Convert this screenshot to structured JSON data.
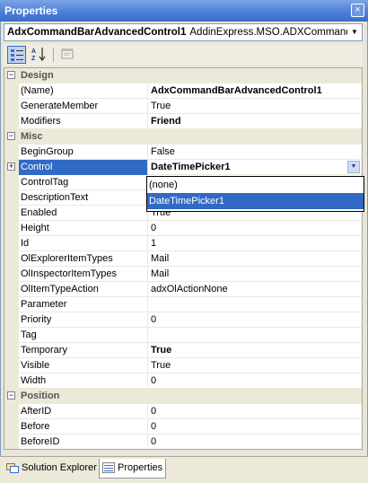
{
  "window": {
    "title": "Properties",
    "close_glyph": "×"
  },
  "object_selector": {
    "name": "AdxCommandBarAdvancedControl1",
    "type": "AddinExpress.MSO.ADXCommandBa",
    "arrow_icon": "chevron-down-icon"
  },
  "toolbar": {
    "buttons": [
      {
        "name": "categorized-button",
        "icon": "categorized-icon",
        "active": true
      },
      {
        "name": "alphabetical-button",
        "icon": "alphabetical-icon",
        "active": false
      },
      {
        "name": "property-pages-button",
        "icon": "property-pages-icon",
        "active": false
      }
    ]
  },
  "grid": {
    "categories": {
      "design": {
        "label": "Design",
        "expander": "−"
      },
      "misc": {
        "label": "Misc",
        "expander": "−"
      },
      "position": {
        "label": "Position",
        "expander": "−"
      }
    },
    "design": [
      {
        "key": "(Name)",
        "value": "AdxCommandBarAdvancedControl1",
        "bold": true
      },
      {
        "key": "GenerateMember",
        "value": "True",
        "bold": false
      },
      {
        "key": "Modifiers",
        "value": "Friend",
        "bold": true
      }
    ],
    "misc": [
      {
        "key": "BeginGroup",
        "value": "False",
        "bold": false
      },
      {
        "key": "Control",
        "value": "DateTimePicker1",
        "bold": true,
        "selected": true,
        "expander": "+"
      },
      {
        "key": "ControlTag",
        "value": "",
        "bold": false
      },
      {
        "key": "DescriptionText",
        "value": "",
        "bold": false
      },
      {
        "key": "Enabled",
        "value": "True",
        "bold": false
      },
      {
        "key": "Height",
        "value": "0",
        "bold": false
      },
      {
        "key": "Id",
        "value": "1",
        "bold": false
      },
      {
        "key": "OlExplorerItemTypes",
        "value": "Mail",
        "bold": false
      },
      {
        "key": "OlInspectorItemTypes",
        "value": "Mail",
        "bold": false
      },
      {
        "key": "OlItemTypeAction",
        "value": "adxOlActionNone",
        "bold": false
      },
      {
        "key": "Parameter",
        "value": "",
        "bold": false
      },
      {
        "key": "Priority",
        "value": "0",
        "bold": false
      },
      {
        "key": "Tag",
        "value": "",
        "bold": false
      },
      {
        "key": "Temporary",
        "value": "True",
        "bold": true
      },
      {
        "key": "Visible",
        "value": "True",
        "bold": false
      },
      {
        "key": "Width",
        "value": "0",
        "bold": false
      }
    ],
    "position": [
      {
        "key": "AfterID",
        "value": "0",
        "bold": false
      },
      {
        "key": "Before",
        "value": "0",
        "bold": false
      },
      {
        "key": "BeforeID",
        "value": "0",
        "bold": false
      }
    ]
  },
  "control_dropdown": {
    "options": [
      "(none)",
      "DateTimePicker1"
    ],
    "highlighted": "DateTimePicker1",
    "button_icon": "chevron-down-icon"
  },
  "tabs": [
    {
      "label": "Solution Explorer",
      "icon": "solution-explorer-icon",
      "active": false
    },
    {
      "label": "Properties",
      "icon": "properties-icon",
      "active": true
    }
  ],
  "colors": {
    "title_bar": "#4e7fd8",
    "selection": "#316ac5",
    "category_bg": "#ece9d8",
    "panel_bg": "#e8e6dc"
  }
}
